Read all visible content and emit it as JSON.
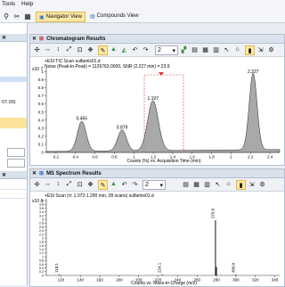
{
  "menu": [
    "Tools",
    "Help"
  ],
  "toolbar": {
    "nav_tab": "Navigator View",
    "compounds_tab": "Compounds View"
  },
  "left_panel": {
    "value1": "07.00(",
    "close": "✕"
  },
  "chromatogram": {
    "title": "Chromatogram Results",
    "zoom_value": "2",
    "info_line1": "+ESI TIC Scan sulfamix01.d",
    "info_line2": "Noise (Peak-to-Peak) = 1126763.0000, SNR (2.227 min) = 23.9",
    "y_multiplier": "x10 7",
    "xlabel": "Counts (%) vs. Acquisition Time (min)",
    "y_ticks": [
      "1",
      "0.9",
      "0.8",
      "0.7",
      "0.6",
      "0.5",
      "0.4",
      "0.3",
      "0.2",
      "0.1",
      "0"
    ],
    "x_ticks": [
      "0.2",
      "0.4",
      "0.6",
      "0.8",
      "1",
      "1.2",
      "1.4",
      "1.6",
      "1.8",
      "2",
      "2.2",
      "2.4"
    ],
    "peak_labels": [
      "0.465",
      "0.879",
      "1.197",
      "2.227"
    ]
  },
  "ms_spectrum": {
    "title": "MS Spectrum Results",
    "zoom_value": "2",
    "info_line1": "+ESI Scan (rt: 1.072-1.290 min, 28 scans) sulfamix01.d",
    "y_multiplier": "x10 6",
    "xlabel": "Counts vs. Mass-to-Charge (m/z)",
    "y_ticks": [
      "4",
      "3.8",
      "3.6",
      "3.4",
      "3.2",
      "3",
      "2.8",
      "2.6",
      "2.4",
      "2.2",
      "2",
      "1.8",
      "1.6",
      "1.4",
      "1.2",
      "1",
      "0.8",
      "0.6",
      "0.4",
      "0.2",
      "0"
    ],
    "x_ticks": [
      "120",
      "140",
      "160",
      "180",
      "200",
      "220",
      "240",
      "260",
      "280",
      "300",
      "320",
      "340"
    ],
    "peak_labels": [
      "118.1",
      "224.1",
      "279.0",
      "300.0"
    ]
  },
  "chart_data": [
    {
      "type": "line",
      "title": "+ESI TIC Scan sulfamix01.d",
      "xlabel": "Counts (%) vs. Acquisition Time (min)",
      "ylabel": "x10 7",
      "xlim": [
        0.1,
        2.5
      ],
      "ylim": [
        0,
        1.05
      ],
      "peaks": [
        {
          "x": 0.465,
          "y": 0.37
        },
        {
          "x": 0.879,
          "y": 0.26
        },
        {
          "x": 1.197,
          "y": 0.62
        },
        {
          "x": 2.227,
          "y": 0.95
        }
      ]
    },
    {
      "type": "bar",
      "title": "+ESI Scan (rt: 1.072-1.290 min, 28 scans) sulfamix01.d",
      "xlabel": "Counts vs. Mass-to-Charge (m/z)",
      "ylabel": "x10 6",
      "xlim": [
        105,
        345
      ],
      "ylim": [
        0,
        4.1
      ],
      "peaks": [
        {
          "x": 118.1,
          "y": 0.05
        },
        {
          "x": 224.1,
          "y": 0.05
        },
        {
          "x": 279.0,
          "y": 2.95
        },
        {
          "x": 280.0,
          "y": 0.45
        },
        {
          "x": 300.0,
          "y": 0.05
        }
      ]
    }
  ]
}
